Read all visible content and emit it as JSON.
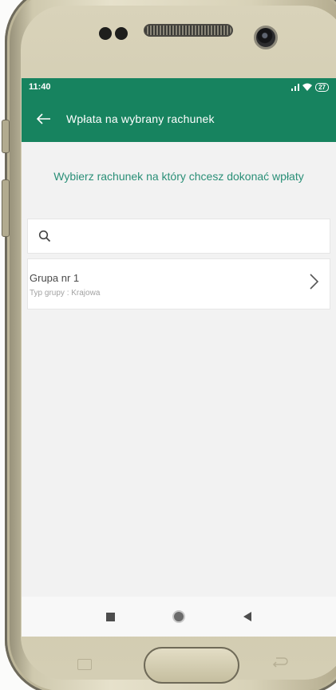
{
  "status_bar": {
    "time": "11:40",
    "battery": "27"
  },
  "app_bar": {
    "back_icon": "arrow-left",
    "title": "Wpłata na wybrany rachunek"
  },
  "prompt": "Wybierz rachunek na który chcesz dokonać wpłaty",
  "search": {
    "placeholder": "",
    "icon": "search-icon"
  },
  "groups": [
    {
      "name": "Grupa nr 1",
      "type": "Typ grupy : Krajowa"
    }
  ],
  "colors": {
    "primary": "#17835f",
    "accent_text": "#2a8f77"
  },
  "nav_bar": {
    "icons": [
      "recent-apps",
      "home",
      "back"
    ]
  }
}
